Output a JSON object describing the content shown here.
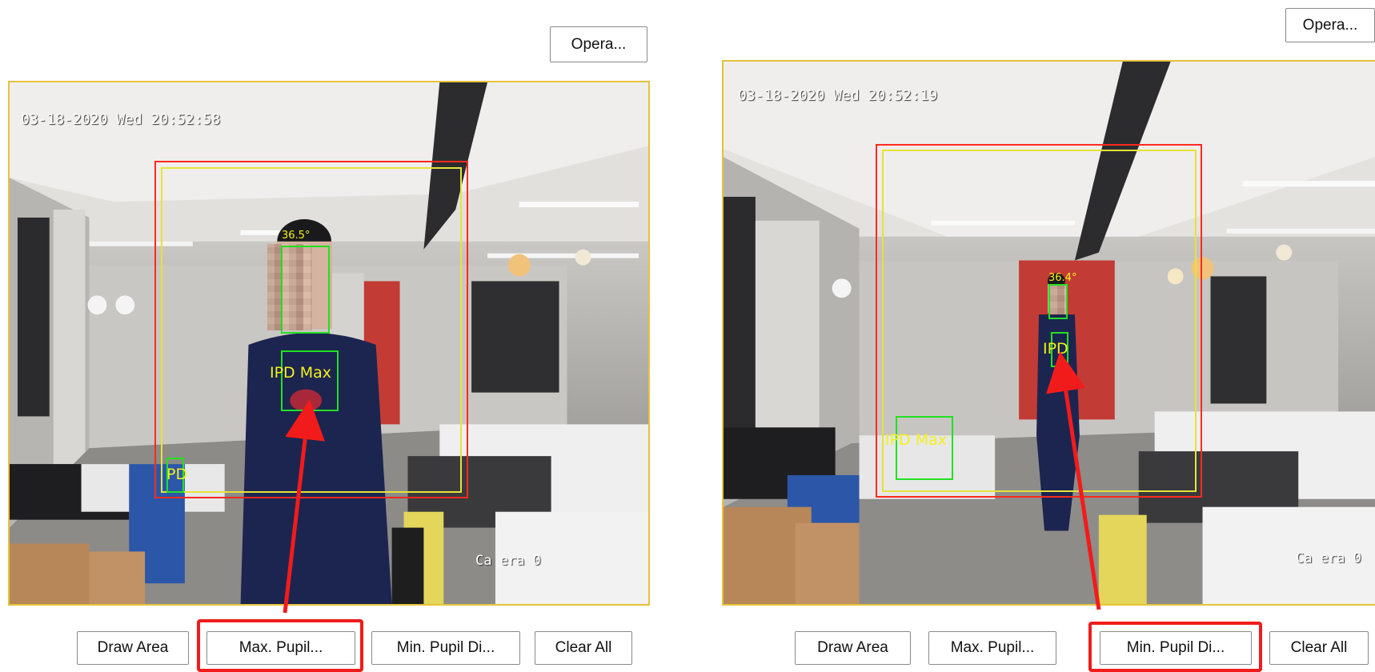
{
  "left": {
    "operation_label": "Opera...",
    "timestamp": "03-18-2020 Wed 20:52:58",
    "camera_text": "Ca era 0",
    "confidence_text": "36.5°",
    "ipd_max_label": "IPD Max",
    "ipd_label": "PD",
    "buttons": {
      "draw_area": "Draw Area",
      "max_pupil": "Max. Pupil...",
      "min_pupil": "Min. Pupil Di...",
      "clear_all": "Clear All"
    },
    "highlighted_button": "max_pupil"
  },
  "right": {
    "operation_label": "Opera...",
    "timestamp": "03-18-2020 Wed 20:52:19",
    "camera_text": "Ca era 0",
    "confidence_text": "36.4°",
    "ipd_max_label": "IPD Max",
    "ipd_label": "IPD",
    "buttons": {
      "draw_area": "Draw Area",
      "max_pupil": "Max. Pupil...",
      "min_pupil": "Min. Pupil Di...",
      "clear_all": "Clear All"
    },
    "highlighted_button": "min_pupil"
  },
  "colors": {
    "roi_red": "#ff2a1e",
    "roi_yellow": "#e6e23a",
    "detect_green": "#22e022",
    "label_yellow": "#f3f01a",
    "highlight_red": "#f21b1b"
  }
}
